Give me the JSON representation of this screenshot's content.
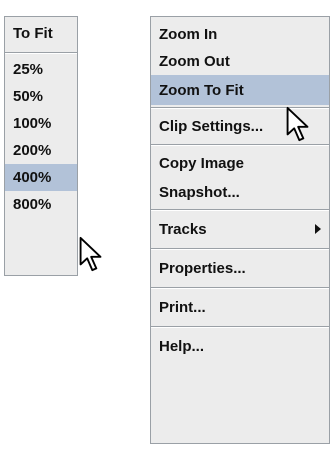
{
  "zoom_menu": {
    "header": "To Fit",
    "items": [
      "25%",
      "50%",
      "100%",
      "200%",
      "400%",
      "800%"
    ],
    "selected": "400%"
  },
  "context_menu": {
    "zoom_in": "Zoom In",
    "zoom_out": "Zoom Out",
    "zoom_to_fit": "Zoom To Fit",
    "clip_settings": "Clip Settings...",
    "copy_image": "Copy Image",
    "snapshot": "Snapshot...",
    "tracks": "Tracks",
    "properties": "Properties...",
    "print": "Print...",
    "help": "Help...",
    "selected": "Zoom To Fit"
  },
  "colors": {
    "menu_bg": "#ececec",
    "selection_bg": "#b2c2d8",
    "border": "#9aa0a6"
  },
  "icons": [
    "mouse-pointer-icon",
    "submenu-arrow-icon"
  ]
}
